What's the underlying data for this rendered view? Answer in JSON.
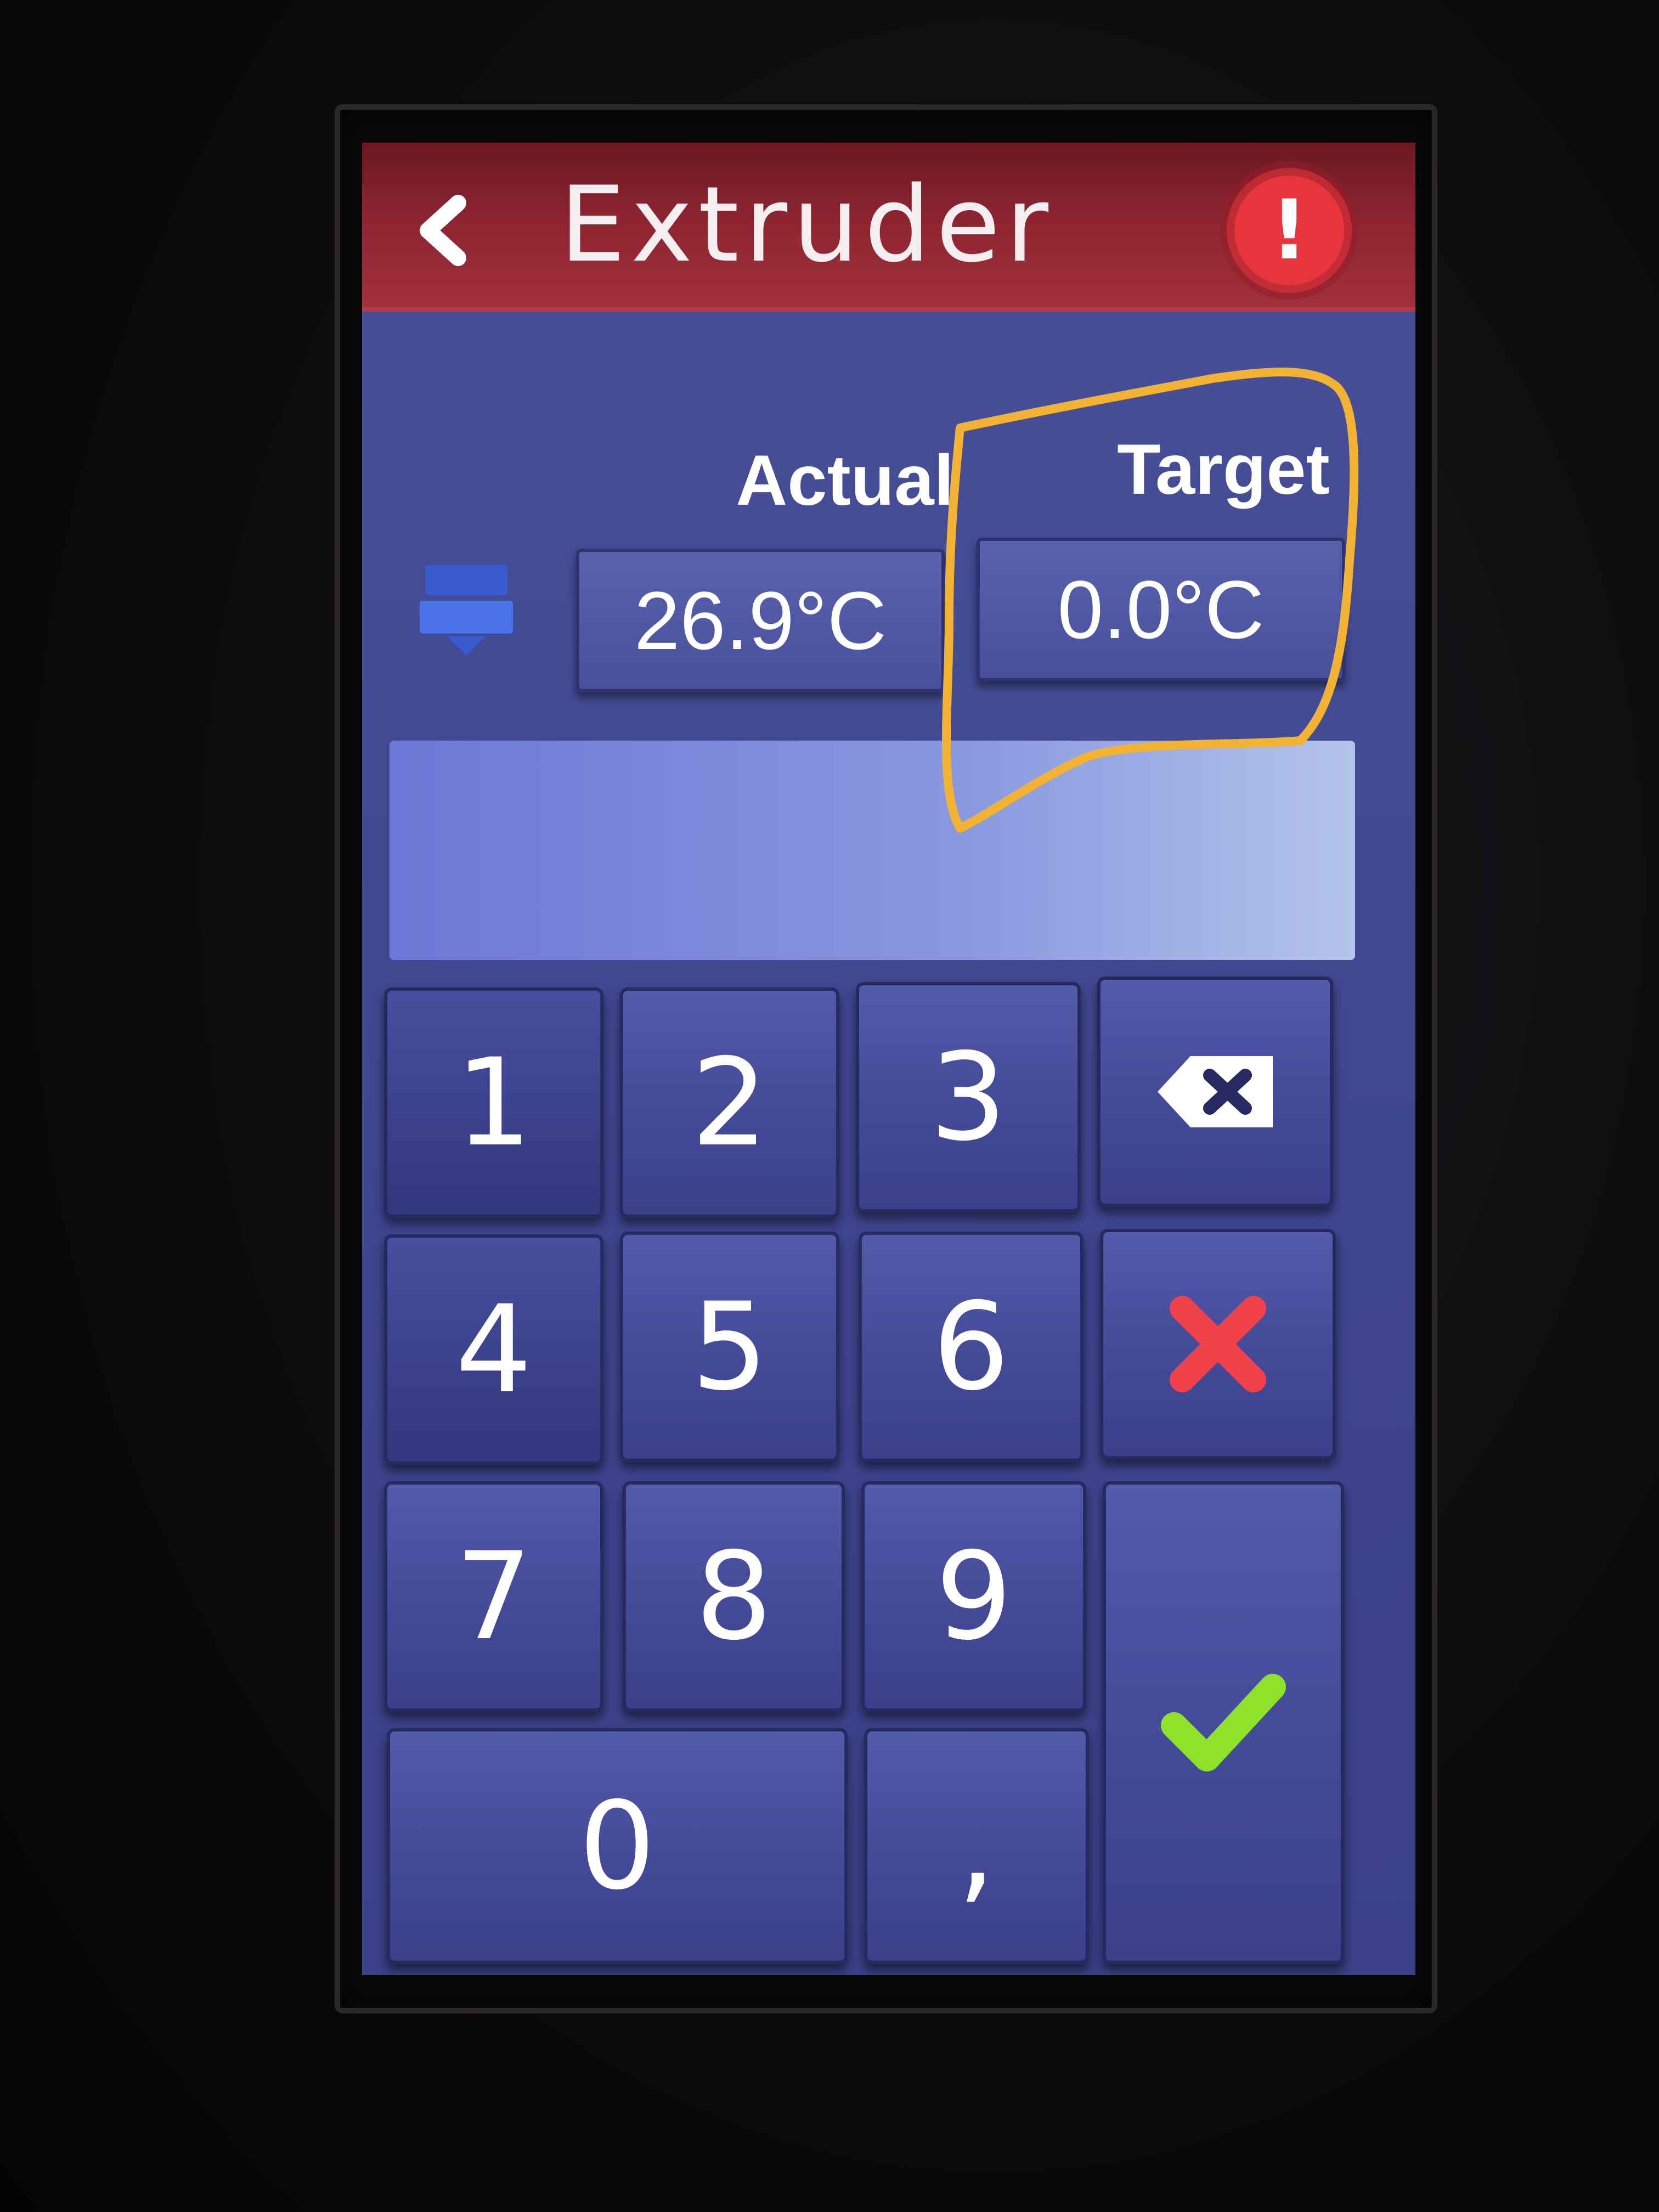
{
  "header": {
    "title": "Extruder",
    "back_icon": "chevron-left-icon",
    "alert_icon": "exclamation-alert-icon",
    "alert_symbol": "!",
    "color": "#8c2430"
  },
  "temperature": {
    "actual_label": "Actual",
    "target_label": "Target",
    "actual_value": "26.9°C",
    "target_value": "0.0°C",
    "heater_icon": "extruder-heater-icon"
  },
  "input": {
    "value": ""
  },
  "keypad": {
    "keys": [
      "1",
      "2",
      "3",
      "4",
      "5",
      "6",
      "7",
      "8",
      "9",
      "0",
      ","
    ],
    "backspace_icon": "backspace-icon",
    "cancel_icon": "cancel-x-icon",
    "confirm_icon": "checkmark-icon",
    "cancel_color": "#f0424a",
    "confirm_color": "#8ee22a"
  },
  "annotation": {
    "highlight_color": "#f2b233"
  }
}
